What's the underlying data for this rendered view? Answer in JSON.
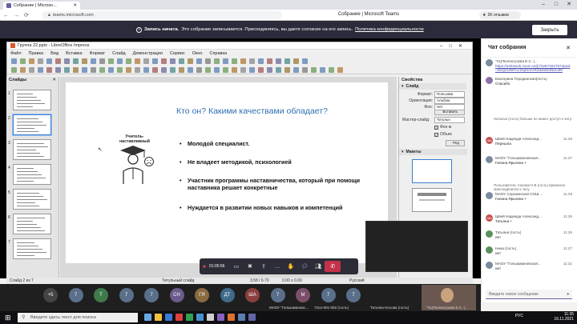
{
  "browser": {
    "tab_title": "Собрание | Microso...",
    "url": "teams.microsoft.com",
    "page_title": "Собрание | Microsoft Teams",
    "badge": "2K отзывов"
  },
  "banner": {
    "title": "Запись начата.",
    "text": "Это собрание записывается. Присоединяясь, вы даете согласие на его запись.",
    "link": "Политика конфиденциальности",
    "close_label": "Закрыть"
  },
  "impress": {
    "window_title": "Группа 22.pptx - LibreOffice Impress",
    "menu": [
      "Файл",
      "Правка",
      "Вид",
      "Вставка",
      "Формат",
      "Слайд",
      "Демонстрация",
      "Сервис",
      "Окно",
      "Справка"
    ],
    "slides_panel_title": "Слайды",
    "slide_numbers": [
      "1",
      "2",
      "3",
      "4",
      "5",
      "6",
      "7"
    ],
    "slide": {
      "title": "Кто он? Какими качествами обладает?",
      "figure_label": "Учитель-наставливный",
      "bullets": [
        "Молодой специалист.",
        "Не владеет методикой, психологией",
        "Участник программы наставничества, который при помощи наставника решает конкретные",
        "Нуждается в развитии новых навыков и компетенций"
      ]
    },
    "properties": {
      "title": "Свойства",
      "section": "Слайд",
      "rows": [
        {
          "label": "Формат:",
          "value": "Пользова"
        },
        {
          "label": "Ориентация:",
          "value": "Альбом"
        },
        {
          "label": "Фон:",
          "value": "Нет"
        }
      ],
      "insert_button": "Вставить",
      "master_label": "Мастер-слайд:",
      "master_value": "Титульн",
      "check1": "Фон м",
      "check2": "Объек",
      "button2": "Ред",
      "layouts_title": "Макеты"
    },
    "status": {
      "slide_counter": "Слайд 2 из 7",
      "layout": "Титульный слайд",
      "position": "3.58 / 6.70",
      "size": "0.00 x 0.00",
      "language": "Русский"
    }
  },
  "call_controls": {
    "timer": "01:05:56"
  },
  "chat": {
    "title": "Чат собрания",
    "messages": [
      {
        "kind": "user",
        "initials": "",
        "color": "#7a8ba0",
        "name": "\"УЦ\"Колногузова Е.С. (...",
        "time": "",
        "text": "https://us04web.zoom.us/j/752973047972pwd=N2Q2UWFoc1NyNmVRZdvbWdNUU09"
      },
      {
        "kind": "user",
        "initials": "",
        "color": "#8f6fa8",
        "name": "Екатерина Городинская(гость)",
        "time": "",
        "text": "Спасибо"
      },
      {
        "kind": "system",
        "text": "Наталья (гость) больше не может доступ к чату."
      },
      {
        "kind": "user",
        "initials": "ША",
        "color": "#c94f4f",
        "name": "Швей Надежда Александ...",
        "time": "11:26",
        "text": "Перешла"
      },
      {
        "kind": "user",
        "initials": "",
        "color": "#7a8ba0",
        "name": "МАОУ \"Голышмановская...",
        "time": "11:27",
        "text": "Галина Ярыгина +"
      },
      {
        "kind": "system",
        "text": "Пользователь Серова Н.В (гость) временно присоединился к чату."
      },
      {
        "kind": "user",
        "initials": "",
        "color": "#7a8ba0",
        "name": "МАОУ Сорокинская СОШ ...",
        "time": "11:29",
        "text": "Галина Ярыгина +"
      },
      {
        "kind": "user",
        "initials": "ША",
        "color": "#c94f4f",
        "name": "Швей Надежда Александ...",
        "time": "11:26",
        "text": "Татьяна +"
      },
      {
        "kind": "user",
        "initials": "",
        "color": "#5b8f5b",
        "name": "Татьяна (гость)",
        "time": "11:26",
        "text": "нет"
      },
      {
        "kind": "user",
        "initials": "",
        "color": "#5b8f5b",
        "name": "Нина (гость)",
        "time": "11:27",
        "text": "нет"
      },
      {
        "kind": "user",
        "initials": "",
        "color": "#7a8ba0",
        "name": "МАОУ \"Голышмановская...",
        "time": "11:31",
        "text": "нет"
      }
    ],
    "input_placeholder": "Введите новое сообщение"
  },
  "participants": [
    {
      "label": "+5",
      "color": "#444"
    },
    {
      "label": "7",
      "color": "#5a6f8a"
    },
    {
      "label": "Т",
      "color": "#3f7a4a"
    },
    {
      "label": "7",
      "color": "#5a6f8a"
    },
    {
      "label": "7",
      "color": "#5a6f8a"
    },
    {
      "label": "СН",
      "color": "#6c5a8a"
    },
    {
      "label": "ГЯ",
      "color": "#8a6a3f"
    },
    {
      "label": "ДТ",
      "color": "#3f6a8a"
    },
    {
      "label": "ША",
      "color": "#8a3f3f"
    },
    {
      "label": "7",
      "color": "#5a6f8a"
    },
    {
      "label": "М",
      "color": "#7a4f6a"
    },
    {
      "label": "7",
      "color": "#5a6f8a"
    },
    {
      "label": "7",
      "color": "#5a6f8a"
    }
  ],
  "participant_names": [
    "МАОУ \"Голышмановс...",
    "72оо-001-002 (гость)",
    "Татьяна Носова (гость)",
    "\"УЦ\"Колногузова Е.С. (..."
  ],
  "taskbar": {
    "search_placeholder": "Введите здесь текст для поиска",
    "language": "РУС",
    "time": "11:35",
    "date": "16.11.2021"
  },
  "colors": {
    "accent": "#6264a7",
    "banner": "#2b2b3b",
    "hangup": "#c4314b",
    "slide_title": "#2f6fb0"
  }
}
